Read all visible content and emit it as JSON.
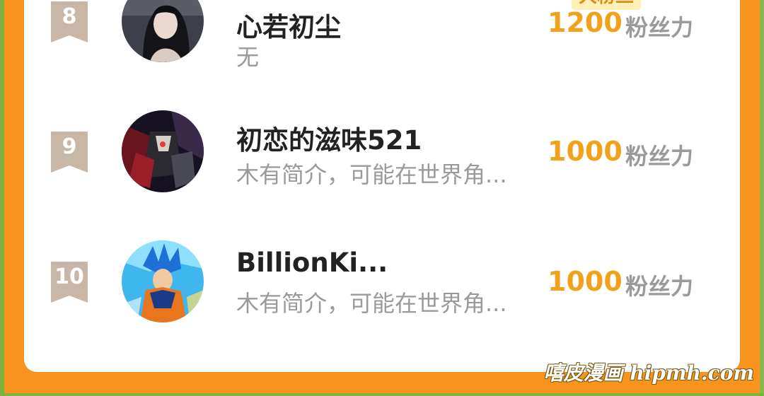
{
  "ranking": {
    "items": [
      {
        "rank": "8",
        "name": "心若初尘",
        "tag": "大粉丝",
        "bio": "无",
        "score": "1200",
        "unit": "粉丝力",
        "avatar_icon": "girl-portrait-avatar"
      },
      {
        "rank": "9",
        "name": "初恋的滋味521",
        "tag": "",
        "bio": "木有简介，可能在世界角...",
        "score": "1000",
        "unit": "粉丝力",
        "avatar_icon": "armored-warrior-avatar"
      },
      {
        "rank": "10",
        "name": "BillionKi...",
        "tag": "",
        "bio": "木有简介，可能在世界角...",
        "score": "1000",
        "unit": "粉丝力",
        "avatar_icon": "super-saiyan-avatar"
      }
    ]
  },
  "watermark": "嘻皮漫画 hipmh.com",
  "colors": {
    "background": "#f7941d",
    "score": "#f2a21a",
    "badge": "#c8b6a6",
    "tag_bg": "#fff0b8"
  }
}
